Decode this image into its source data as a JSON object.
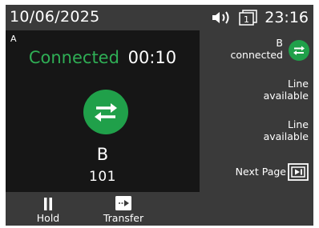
{
  "status_bar": {
    "date": "10/06/2025",
    "time": "23:16",
    "speaker_icon": "speaker-icon",
    "counter_icon": "active-calls-icon",
    "counter_value": "1"
  },
  "call": {
    "line_label": "A",
    "state": "Connected",
    "duration": "00:10",
    "icon": "call-transfer-icon",
    "name": "B",
    "number": "101",
    "accent_color": "#20a04a"
  },
  "line_keys": [
    {
      "label_line1": "B",
      "label_line2": "connected",
      "icon": "call-transfer-icon"
    },
    {
      "label_line1": "Line",
      "label_line2": "available"
    },
    {
      "label_line1": "Line",
      "label_line2": "available"
    },
    {
      "label_line1": "Next Page",
      "icon": "next-page-icon"
    }
  ],
  "soft_keys": [
    {
      "label": "Hold",
      "icon": "pause-icon"
    },
    {
      "label": "Transfer",
      "icon": "transfer-arrow-icon"
    }
  ]
}
